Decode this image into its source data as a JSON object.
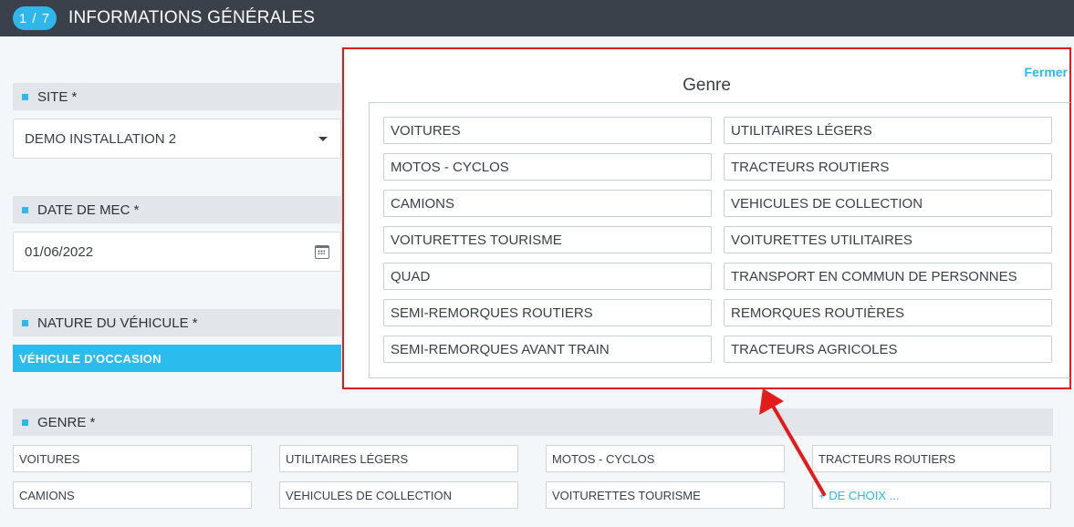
{
  "header": {
    "step": "1 / 7",
    "title": "INFORMATIONS GÉNÉRALES"
  },
  "site": {
    "label": "SITE *",
    "value": "DEMO INSTALLATION 2"
  },
  "date_mec": {
    "label": "DATE DE MEC *",
    "value": "01/06/2022"
  },
  "nature": {
    "label": "NATURE DU VÉHICULE *",
    "selected": "VÉHICULE D'OCCASION"
  },
  "genre": {
    "label": "GENRE *",
    "options": [
      "VOITURES",
      "UTILITAIRES LÉGERS",
      "MOTOS - CYCLOS",
      "TRACTEURS ROUTIERS",
      "CAMIONS",
      "VEHICULES DE COLLECTION",
      "VOITURETTES TOURISME"
    ],
    "more_label": "+ DE CHOIX ..."
  },
  "popup": {
    "close_label": "Fermer",
    "title": "Genre",
    "items": [
      "VOITURES",
      "UTILITAIRES LÉGERS",
      "MOTOS - CYCLOS",
      "TRACTEURS ROUTIERS",
      "CAMIONS",
      "VEHICULES DE COLLECTION",
      "VOITURETTES TOURISME",
      "VOITURETTES UTILITAIRES",
      "QUAD",
      "TRANSPORT EN COMMUN DE PERSONNES",
      "SEMI-REMORQUES ROUTIERS",
      "REMORQUES ROUTIÈRES",
      "SEMI-REMORQUES AVANT TRAIN",
      "TRACTEURS AGRICOLES"
    ]
  },
  "colors": {
    "accent": "#2fb6ea",
    "topbar": "#3b414b",
    "highlight": "#e31b1b"
  },
  "icons": {
    "site_dropdown": "chevron-down-icon",
    "date_picker": "calendar-icon"
  }
}
